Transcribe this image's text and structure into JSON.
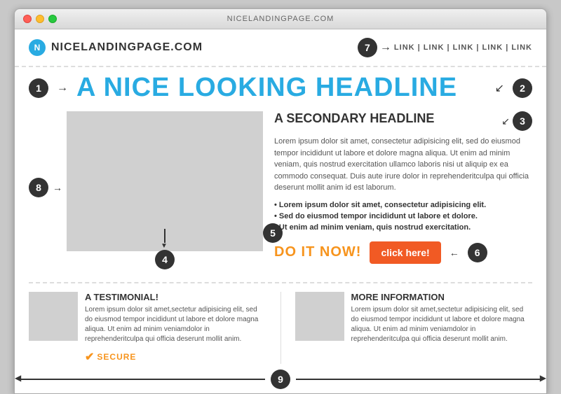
{
  "browser": {
    "title": "NICELANDINGPAGE.COM"
  },
  "header": {
    "logo_letter": "N",
    "logo_text": "NICELANDINGPAGE.COM",
    "nav_number": "7",
    "nav_links": "LINK | LINK | LINK | LINK | LINK"
  },
  "labels": {
    "num1": "1",
    "num2": "2",
    "num3": "3",
    "num4": "4",
    "num5": "5",
    "num6": "6",
    "num7": "7",
    "num8": "8",
    "num9": "9"
  },
  "hero": {
    "main_headline": "A NICE LOOKING HEADLINE",
    "secondary_headline": "A SECONDARY HEADLINE"
  },
  "body_text": {
    "paragraph": "Lorem ipsum dolor sit amet, consectetur adipisicing elit, sed do eiusmod tempor incididunt ut labore et dolore magna aliqua. Ut enim ad minim veniam, quis nostrud exercitation ullamco laboris nisi ut aliquip ex ea commodo consequat. Duis aute irure dolor in reprehenderitculpa qui officia deserunt mollit anim id est laborum.",
    "bullets": [
      "Lorem ipsum dolor sit amet, consectetur adipisicing elit.",
      "Sed do eiusmod tempor incididunt ut labore et dolore.",
      "Ut enim ad minim veniam, quis nostrud exercitation."
    ]
  },
  "cta": {
    "do_it_now": "DO IT NOW!",
    "click_here": "click here!"
  },
  "testimonial": {
    "title": "A TESTIMONIAL!",
    "body": "Lorem ipsum dolor sit amet,sectetur adipisicing elit, sed do eiusmod tempor incididunt ut labore et dolore magna aliqua. Ut enim ad minim veniamdolor in reprehenderitculpa qui officia deserunt mollit anim."
  },
  "info": {
    "title": "MORE INFORMATION",
    "body": "Lorem ipsum dolor sit amet,sectetur adipisicing elit, sed do eiusmod tempor incididunt ut labore et dolore magna aliqua. Ut enim ad minim veniamdolor in reprehenderitculpa qui officia deserunt mollit anim."
  },
  "secure": {
    "text": "SECURE"
  }
}
